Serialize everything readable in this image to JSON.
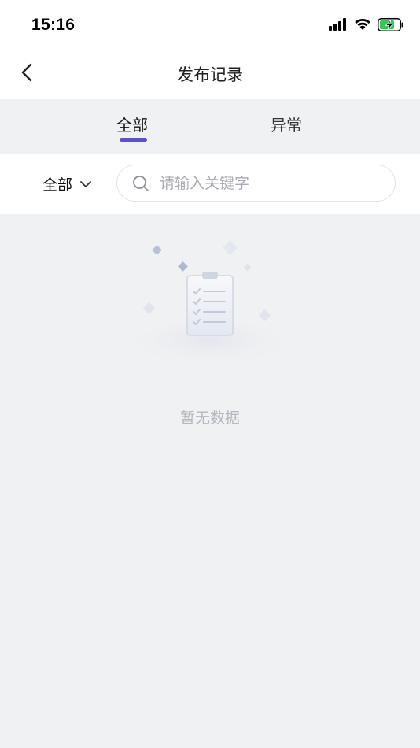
{
  "status_bar": {
    "time": "15:16",
    "icons": [
      "signal-icon",
      "wifi-icon",
      "battery-charging-icon"
    ]
  },
  "nav": {
    "title": "发布记录",
    "back_icon": "chevron-left-icon"
  },
  "tabs": [
    {
      "label": "全部",
      "active": true
    },
    {
      "label": "异常",
      "active": false
    }
  ],
  "filter": {
    "selected": "全部",
    "dropdown_icon": "chevron-down-icon"
  },
  "search": {
    "placeholder": "请输入关键字",
    "value": ""
  },
  "empty_state": {
    "icon": "empty-clipboard-icon",
    "text": "暂无数据"
  },
  "colors": {
    "accent": "#5b4fd8",
    "page_background": "#f0f1f3",
    "battery_fill": "#34c759"
  }
}
